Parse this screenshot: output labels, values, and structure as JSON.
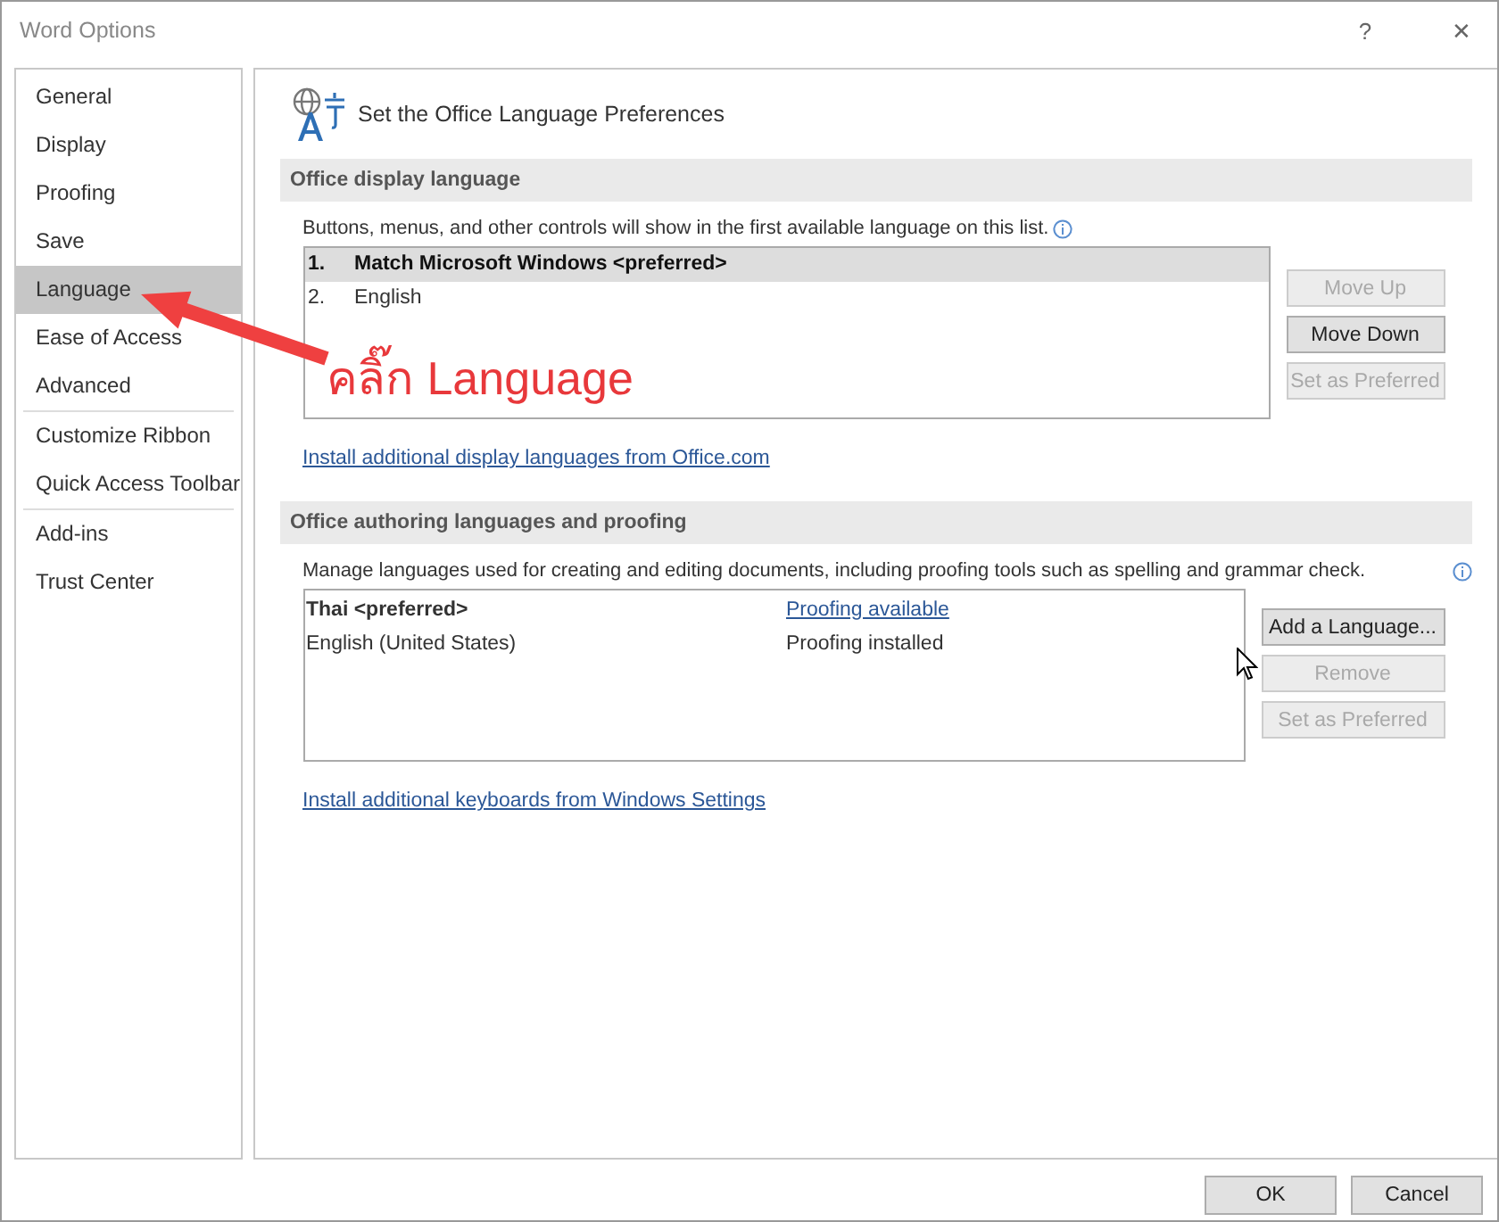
{
  "window": {
    "title": "Word Options",
    "help": "?",
    "close": "✕"
  },
  "sidebar": {
    "groups": [
      [
        {
          "label": "General",
          "selected": false
        },
        {
          "label": "Display",
          "selected": false
        },
        {
          "label": "Proofing",
          "selected": false
        },
        {
          "label": "Save",
          "selected": false
        },
        {
          "label": "Language",
          "selected": true
        },
        {
          "label": "Ease of Access",
          "selected": false
        },
        {
          "label": "Advanced",
          "selected": false
        }
      ],
      [
        {
          "label": "Customize Ribbon",
          "selected": false
        },
        {
          "label": "Quick Access Toolbar",
          "selected": false
        }
      ],
      [
        {
          "label": "Add-ins",
          "selected": false
        },
        {
          "label": "Trust Center",
          "selected": false
        }
      ]
    ]
  },
  "page_title": "Set the Office Language Preferences",
  "display_section": {
    "heading": "Office display language",
    "description": "Buttons, menus, and other controls will show in the first available language on this list.",
    "rows": [
      {
        "number": "1.",
        "name": "Match Microsoft Windows <preferred>",
        "selected": true
      },
      {
        "number": "2.",
        "name": "English",
        "selected": false
      }
    ],
    "buttons": [
      {
        "label": "Move Up",
        "disabled": true
      },
      {
        "label": "Move Down",
        "disabled": false
      },
      {
        "label": "Set as Preferred",
        "disabled": true
      }
    ],
    "link": "Install additional display languages from Office.com"
  },
  "authoring_section": {
    "heading": "Office authoring languages and proofing",
    "description": "Manage languages used for creating and editing documents, including proofing tools such as spelling and grammar check.",
    "rows": [
      {
        "language": "Thai <preferred>",
        "preferred": true,
        "status": "Proofing available",
        "kind": "link"
      },
      {
        "language": "English (United States)",
        "preferred": false,
        "status": "Proofing installed",
        "kind": "text"
      }
    ],
    "buttons": [
      {
        "label": "Add a Language...",
        "disabled": false
      },
      {
        "label": "Remove",
        "disabled": true
      },
      {
        "label": "Set as Preferred",
        "disabled": true
      }
    ],
    "link": "Install additional keyboards from Windows Settings"
  },
  "annotation": {
    "text": "คลิ๊ก Language"
  },
  "footer_buttons": [
    "OK",
    "Cancel"
  ]
}
